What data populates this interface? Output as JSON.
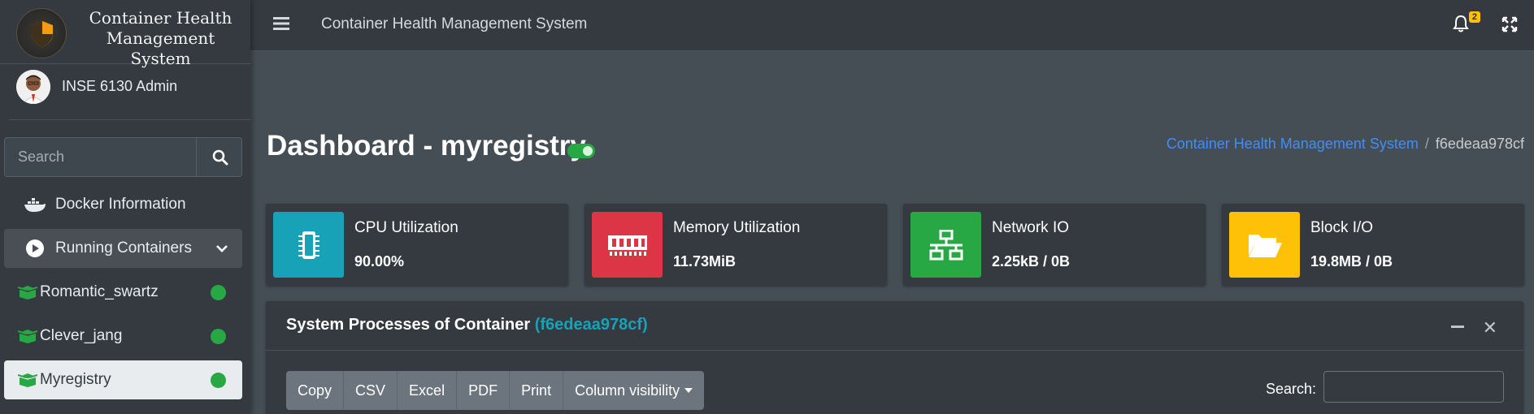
{
  "brand": {
    "title_line1": "Container Health",
    "title_line2": "Management System"
  },
  "user": {
    "name": "INSE 6130 Admin"
  },
  "search": {
    "placeholder": "Search"
  },
  "sidebar": {
    "items": [
      {
        "label": "Docker Information",
        "icon": "docker-icon"
      },
      {
        "label": "Running Containers",
        "icon": "play-circle-icon"
      },
      {
        "label": "Romantic_swartz",
        "icon": "box-icon",
        "status": "running"
      },
      {
        "label": "Clever_jang",
        "icon": "box-icon",
        "status": "running"
      },
      {
        "label": "Myregistry",
        "icon": "box-icon",
        "status": "running"
      }
    ]
  },
  "topbar": {
    "title": "Container Health Management System",
    "notification_count": "2"
  },
  "header": {
    "title": "Dashboard - myregistry"
  },
  "breadcrumb": {
    "home": "Container Health Management System",
    "current": "f6edeaa978cf"
  },
  "info_boxes": [
    {
      "label": "CPU Utilization",
      "value": "90.00%",
      "color": "#17a2b8",
      "icon": "cpu-chip-icon"
    },
    {
      "label": "Memory Utilization",
      "value": "11.73MiB",
      "color": "#dc3545",
      "icon": "memory-icon"
    },
    {
      "label": "Network IO",
      "value": "2.25kB / 0B",
      "color": "#28a745",
      "icon": "network-icon"
    },
    {
      "label": "Block I/O",
      "value": "19.8MB / 0B",
      "color": "#ffc107",
      "icon": "folder-open-icon"
    }
  ],
  "card": {
    "title": "System Processes of Container",
    "container_id": "(f6edeaa978cf)",
    "buttons": [
      "Copy",
      "CSV",
      "Excel",
      "PDF",
      "Print",
      "Column visibility"
    ],
    "search_label": "Search:"
  },
  "colors": {
    "accent_green": "#28a745",
    "link_blue": "#3f8efc",
    "sidebar_bg": "#343a40",
    "content_bg": "#454d55"
  }
}
